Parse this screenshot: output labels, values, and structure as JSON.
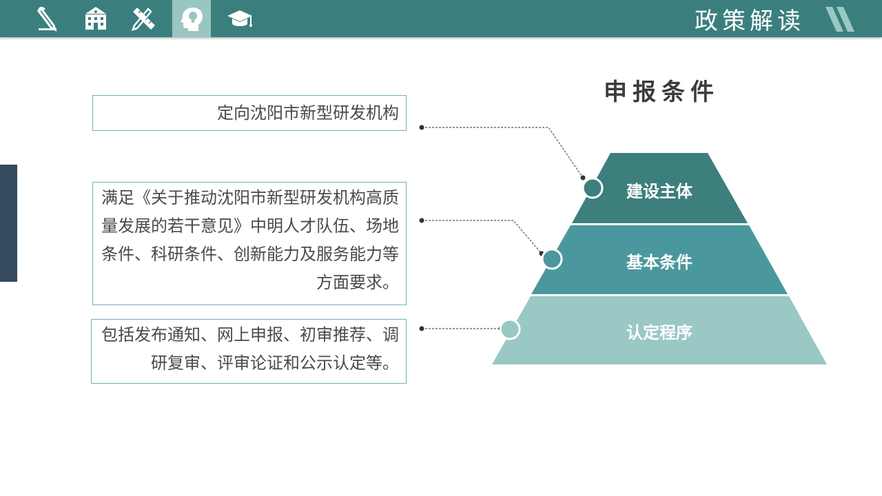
{
  "header": {
    "section_title": "政策解读",
    "nav_icons": [
      {
        "name": "pencil-paperclip-icon",
        "active": false
      },
      {
        "name": "school-building-icon",
        "active": false
      },
      {
        "name": "ruler-pencil-icon",
        "active": false
      },
      {
        "name": "head-lightbulb-icon",
        "active": true
      },
      {
        "name": "graduation-cap-icon",
        "active": false
      }
    ]
  },
  "colors": {
    "bar": "#3a7f7e",
    "tier1": "#3c7f7d",
    "tier2": "#4a989d",
    "tier3": "#9ac8c4",
    "accent_dark": "#344a5e"
  },
  "pyramid": {
    "title": "申报条件",
    "tiers": [
      {
        "label": "建设主体"
      },
      {
        "label": "基本条件"
      },
      {
        "label": "认定程序"
      }
    ]
  },
  "descriptions": [
    {
      "text": "定向沈阳市新型研发机构"
    },
    {
      "text": "满足《关于推动沈阳市新型研发机构高质量发展的若干意见》中明人才队伍、场地条件、科研条件、创新能力及服务能力等方面要求。"
    },
    {
      "text": "包括发布通知、网上申报、初审推荐、调研复审、评审论证和公示认定等。"
    }
  ]
}
